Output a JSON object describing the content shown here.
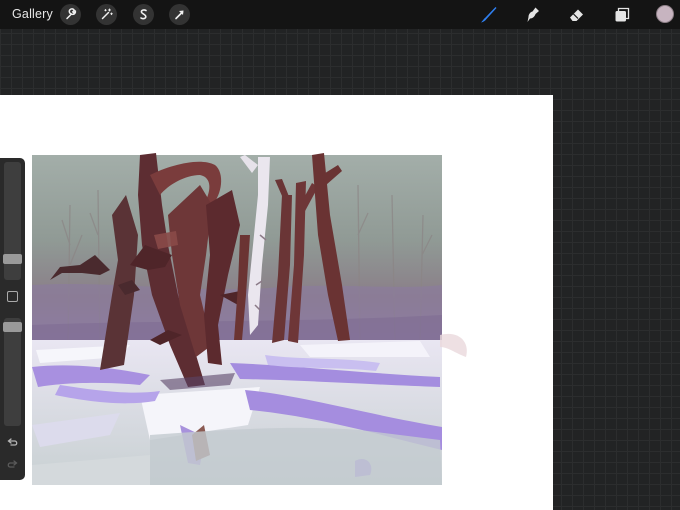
{
  "toolbar": {
    "gallery_label": "Gallery",
    "left_tools": [
      "wrench-icon",
      "magic-wand-icon",
      "selection-s-icon",
      "transform-arrow-icon"
    ],
    "right_tools": [
      "brush-icon",
      "smudge-icon",
      "eraser-icon",
      "layers-icon"
    ],
    "active_tool": "brush-icon",
    "accent_color": "#2f7ff0",
    "current_color": "#c7b4c0"
  },
  "sidebar": {
    "brush_size_level": 0.65,
    "opacity_level": 0.98,
    "buttons": [
      "modify-button",
      "undo-button",
      "redo-button"
    ]
  },
  "canvas": {
    "background_color": "#ffffff",
    "artwork_subject": "snowy-forest-painting",
    "palette": [
      "#9aa6a1",
      "#6f3c3d",
      "#cfc8ee",
      "#a58ddf",
      "#e5e3ec",
      "#c1c9cb"
    ]
  }
}
